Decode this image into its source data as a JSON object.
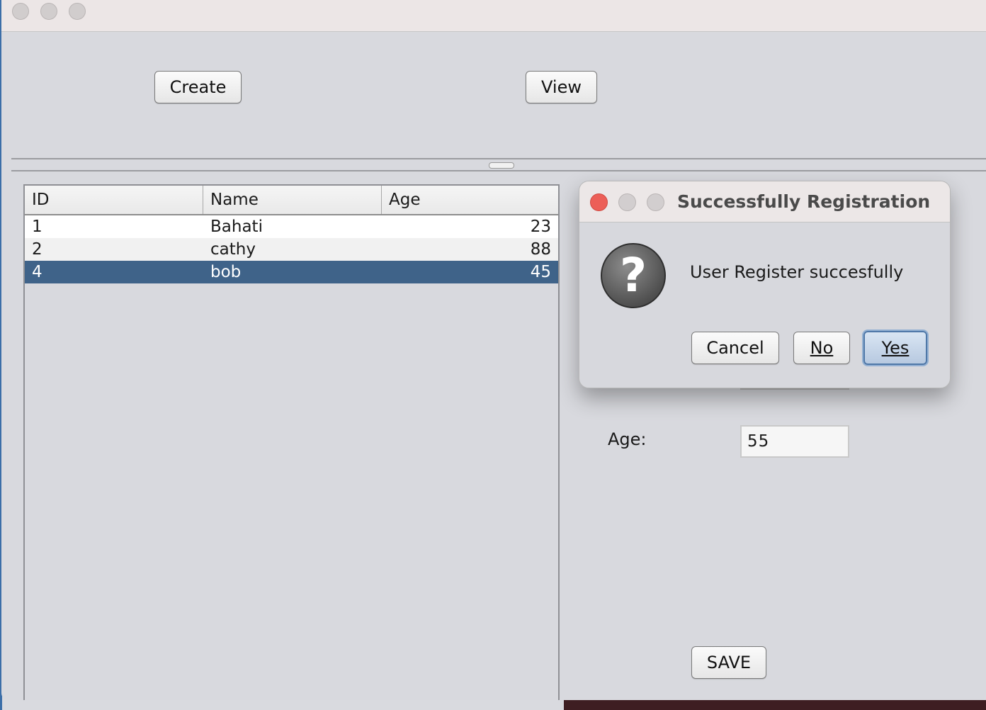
{
  "main": {
    "create_label": "Create",
    "view_label": "View",
    "save_label": "SAVE"
  },
  "table": {
    "columns": [
      "ID",
      "Name",
      "Age"
    ],
    "rows": [
      {
        "id": "1",
        "name": "Bahati",
        "age": "23"
      },
      {
        "id": "2",
        "name": "cathy",
        "age": "88"
      },
      {
        "id": "4",
        "name": "bob",
        "age": "45"
      }
    ],
    "selected_row_index": 2
  },
  "form": {
    "age_label": "Age:",
    "age_value": "55"
  },
  "dialog": {
    "title": "Successfully Registration",
    "message": "User Register succesfully",
    "cancel_label": "Cancel",
    "no_label": "No",
    "yes_label": "Yes",
    "icon": "question-icon"
  },
  "colors": {
    "selection": "#3f6389",
    "close_button": "#ec5f58",
    "default_button_border": "#4f78a8"
  }
}
